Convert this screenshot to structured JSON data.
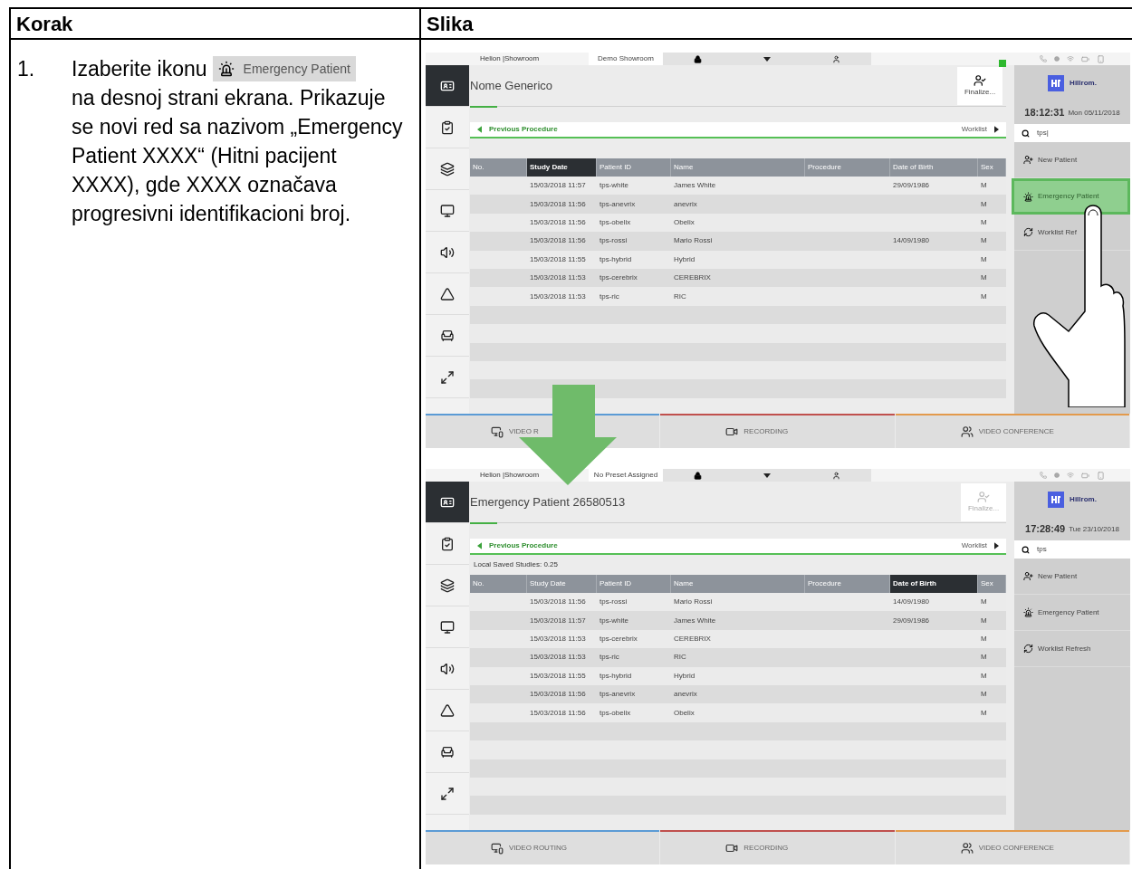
{
  "header": {
    "columns": [
      {
        "label": "Korak"
      },
      {
        "label": "Slika"
      }
    ]
  },
  "step": {
    "number": "1.",
    "text_before": "Izaberite ikonu",
    "chip_label": "Emergency Patient",
    "text_after": "na desnoj strani ekrana. Prikazuje se novi red sa nazivom „Emergency Patient XXXX“ (Hitni pacijent XXXX), gde XXXX označava progresivni identifikacioni broj."
  },
  "transition_arrow": true,
  "screens": [
    {
      "touch_hint": true,
      "status_bar": {
        "site": "Helion |Showroom",
        "preset": "Demo Showroom"
      },
      "title": "Nome Generico",
      "finalize": {
        "label": "Finalize...",
        "disabled": false,
        "badge": true
      },
      "sidebar": [
        {
          "kind": "card",
          "selected": true
        },
        {
          "kind": "clipboard",
          "selected": false
        },
        {
          "kind": "stack",
          "selected": false
        },
        {
          "kind": "monitor",
          "selected": false
        },
        {
          "kind": "speaker",
          "selected": false
        },
        {
          "kind": "light",
          "selected": false
        },
        {
          "kind": "chair",
          "selected": false
        },
        {
          "kind": "expand",
          "selected": false
        }
      ],
      "breadcrumb": {
        "back": "Previous Procedure",
        "forward": "Worklist"
      },
      "table": {
        "columns": [
          {
            "label": "No.",
            "sorted": false
          },
          {
            "label": "Study Date",
            "sorted": true
          },
          {
            "label": "Patient ID",
            "sorted": false
          },
          {
            "label": "Name",
            "sorted": false
          },
          {
            "label": "Procedure",
            "sorted": false
          },
          {
            "label": "Date of Birth",
            "sorted": false
          },
          {
            "label": "Sex",
            "sorted": false
          }
        ],
        "rows": [
          [
            "",
            "15/03/2018 11:57",
            "tps-white",
            "James White",
            "",
            "29/09/1986",
            "M"
          ],
          [
            "",
            "15/03/2018 11:56",
            "tps-anevrix",
            "anevrix",
            "",
            "",
            "M"
          ],
          [
            "",
            "15/03/2018 11:56",
            "tps-obelix",
            "Obelix",
            "",
            "",
            "M"
          ],
          [
            "",
            "15/03/2018 11:56",
            "tps-rossi",
            "Mario Rossi",
            "",
            "14/09/1980",
            "M"
          ],
          [
            "",
            "15/03/2018 11:55",
            "tps-hybrid",
            "Hybrid",
            "",
            "",
            "M"
          ],
          [
            "",
            "15/03/2018 11:53",
            "tps-cerebrix",
            "CEREBRIX",
            "",
            "",
            "M"
          ],
          [
            "",
            "15/03/2018 11:53",
            "tps-ric",
            "RIC",
            "",
            "",
            "M"
          ]
        ]
      },
      "right_panel": {
        "brand": "Hillrom.",
        "time": "18:12:31",
        "date": "Mon 05/11/2018",
        "search": "tps|",
        "actions": [
          {
            "kind": "new-patient",
            "label": "New Patient",
            "selected": false
          },
          {
            "kind": "emergency",
            "label": "Emergency Patient",
            "selected": true
          },
          {
            "kind": "refresh",
            "label": "Worklist Ref",
            "selected": false
          }
        ]
      },
      "tabs": [
        {
          "kind": "routing",
          "label": "VIDEO R",
          "color": "#5b9bd5"
        },
        {
          "kind": "recording",
          "label": "RECORDING",
          "color": "#c0504d"
        },
        {
          "kind": "conference",
          "label": "VIDEO CONFERENCE",
          "color": "#e39a4c"
        }
      ]
    },
    {
      "touch_hint": false,
      "status_bar": {
        "site": "Helion |Showroom",
        "preset": "No Preset Assigned"
      },
      "title": "Emergency Patient 26580513",
      "finalize": {
        "label": "Finalize...",
        "disabled": true,
        "badge": false
      },
      "sidebar": [
        {
          "kind": "card",
          "selected": true
        },
        {
          "kind": "clipboard",
          "selected": false
        },
        {
          "kind": "stack",
          "selected": false
        },
        {
          "kind": "monitor",
          "selected": false
        },
        {
          "kind": "speaker",
          "selected": false
        },
        {
          "kind": "light",
          "selected": false
        },
        {
          "kind": "chair",
          "selected": false
        },
        {
          "kind": "expand",
          "selected": false
        }
      ],
      "breadcrumb": {
        "back": "Previous Procedure",
        "forward": "Worklist"
      },
      "info": "Local Saved Studies: 0.25",
      "table": {
        "columns": [
          {
            "label": "No.",
            "sorted": false
          },
          {
            "label": "Study Date",
            "sorted": false
          },
          {
            "label": "Patient ID",
            "sorted": false
          },
          {
            "label": "Name",
            "sorted": false
          },
          {
            "label": "Procedure",
            "sorted": false
          },
          {
            "label": "Date of Birth",
            "sorted": true
          },
          {
            "label": "Sex",
            "sorted": false
          }
        ],
        "rows": [
          [
            "",
            "15/03/2018 11:56",
            "tps-rossi",
            "Mario Rossi",
            "",
            "14/09/1980",
            "M"
          ],
          [
            "",
            "15/03/2018 11:57",
            "tps-white",
            "James White",
            "",
            "29/09/1986",
            "M"
          ],
          [
            "",
            "15/03/2018 11:53",
            "tps-cerebrix",
            "CEREBRIX",
            "",
            "",
            "M"
          ],
          [
            "",
            "15/03/2018 11:53",
            "tps-ric",
            "RIC",
            "",
            "",
            "M"
          ],
          [
            "",
            "15/03/2018 11:55",
            "tps-hybrid",
            "Hybrid",
            "",
            "",
            "M"
          ],
          [
            "",
            "15/03/2018 11:56",
            "tps-anevrix",
            "anevrix",
            "",
            "",
            "M"
          ],
          [
            "",
            "15/03/2018 11:56",
            "tps-obelix",
            "Obelix",
            "",
            "",
            "M"
          ]
        ]
      },
      "right_panel": {
        "brand": "Hillrom.",
        "time": "17:28:49",
        "date": "Tue 23/10/2018",
        "search": "tps",
        "actions": [
          {
            "kind": "new-patient",
            "label": "New Patient",
            "selected": false
          },
          {
            "kind": "emergency",
            "label": "Emergency Patient",
            "selected": false
          },
          {
            "kind": "refresh",
            "label": "Worklist Refresh",
            "selected": false
          }
        ]
      },
      "tabs": [
        {
          "kind": "routing",
          "label": "VIDEO ROUTING",
          "color": "#5b9bd5"
        },
        {
          "kind": "recording",
          "label": "RECORDING",
          "color": "#c0504d"
        },
        {
          "kind": "conference",
          "label": "VIDEO CONFERENCE",
          "color": "#e39a4c"
        }
      ]
    }
  ]
}
